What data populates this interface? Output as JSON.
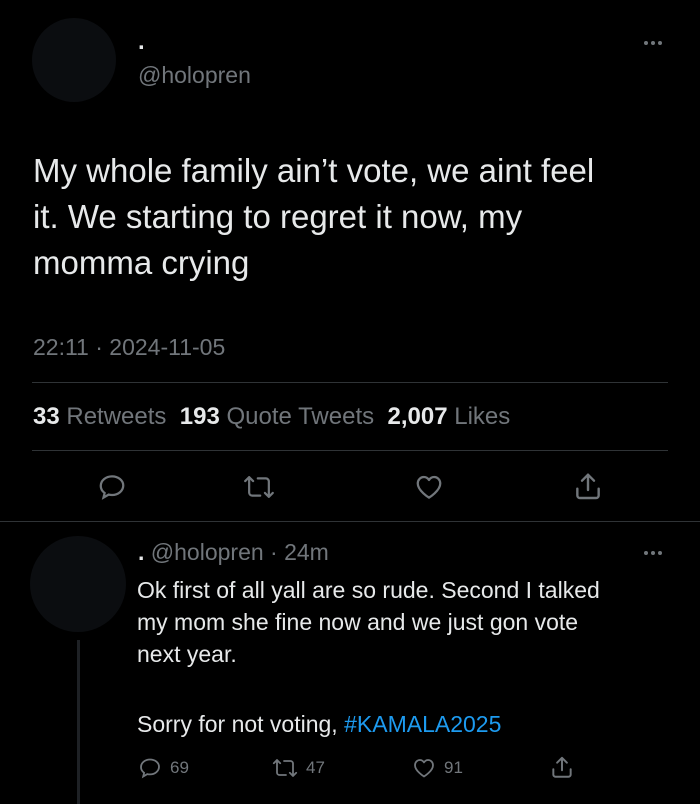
{
  "tweet": {
    "display_name": ".",
    "handle": "@holopren",
    "text_lines": [
      "My whole family ain’t vote, we aint feel",
      "it. We starting to regret it now, my",
      "momma crying"
    ],
    "timestamp": "22:11 · 2024-11-05",
    "stats": {
      "retweets_count": "33",
      "retweets_label": "Retweets",
      "quotes_count": "193",
      "quotes_label": "Quote Tweets",
      "likes_count": "2,007",
      "likes_label": "Likes"
    },
    "actions": [
      "reply-icon",
      "retweet-icon",
      "like-icon",
      "share-icon"
    ]
  },
  "reply": {
    "display_name": ".",
    "handle": "@holopren",
    "time": "· 24m",
    "text_lines": [
      "Ok first of all yall are so rude. Second I talked",
      "my mom she fine now and we just gon vote",
      "next year."
    ],
    "closing_text": "Sorry for not voting, ",
    "hashtag": "#KAMALA2025",
    "counts": {
      "replies": "69",
      "retweets": "47",
      "likes": "91"
    }
  },
  "colors": {
    "background": "#000000",
    "text": "#e7e9ea",
    "muted": "#71767b",
    "link": "#1d9bf0",
    "divider": "#2f3336"
  }
}
